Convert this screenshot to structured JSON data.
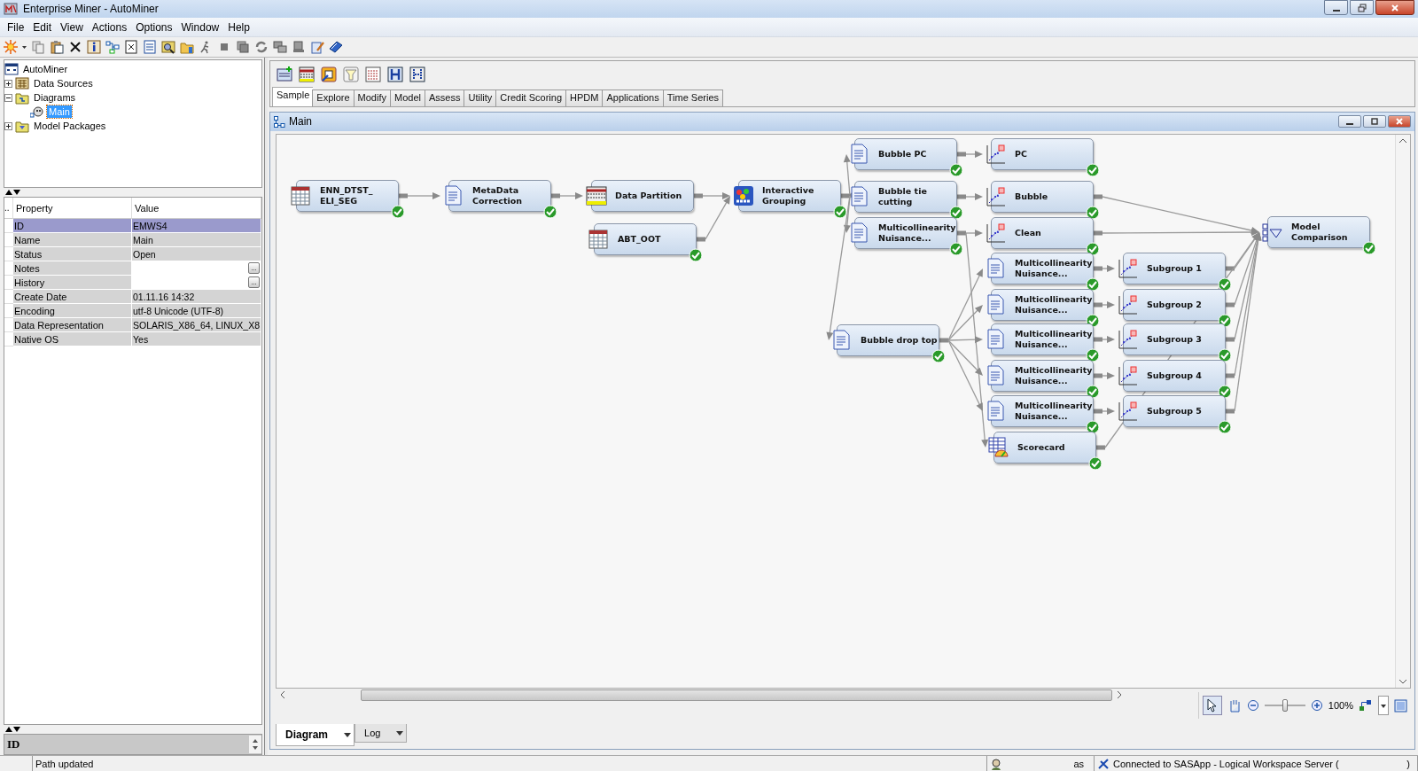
{
  "window": {
    "title": "Enterprise Miner - AutoMiner"
  },
  "menu": [
    "File",
    "Edit",
    "View",
    "Actions",
    "Options",
    "Window",
    "Help"
  ],
  "project_tree": [
    {
      "label": "AutoMiner",
      "kind": "project",
      "children": [
        {
          "label": "Data Sources",
          "kind": "datasources",
          "expanded": false,
          "selected": false
        },
        {
          "label": "Diagrams",
          "kind": "diagrams",
          "expanded": true,
          "selected": false,
          "children": [
            {
              "label": "Main",
              "kind": "diagram",
              "selected": true
            }
          ]
        },
        {
          "label": "Model Packages",
          "kind": "packages",
          "expanded": false,
          "selected": false
        }
      ]
    }
  ],
  "properties": {
    "header_marker": "..",
    "columns": [
      "Property",
      "Value"
    ],
    "rows": [
      {
        "name": "ID",
        "value": "EMWS4",
        "selected": true
      },
      {
        "name": "Name",
        "value": "Main",
        "selected": false
      },
      {
        "name": "Status",
        "value": "Open",
        "selected": false
      },
      {
        "name": "Notes",
        "editor_button": "...",
        "selected": false
      },
      {
        "name": "History",
        "editor_button": "...",
        "selected": false
      },
      {
        "name": "Create Date",
        "value": "01.11.16 14:32",
        "selected": false
      },
      {
        "name": "Encoding",
        "value": "utf-8  Unicode (UTF-8)",
        "selected": false
      },
      {
        "name": "Data Representation",
        "value": "SOLARIS_X86_64, LINUX_X8",
        "selected": false
      },
      {
        "name": "Native OS",
        "value": "Yes",
        "selected": false
      }
    ]
  },
  "description_field": {
    "title": "ID"
  },
  "node_tabs": [
    {
      "label": "Sample",
      "selected": true
    },
    {
      "label": "Explore",
      "selected": false
    },
    {
      "label": "Modify",
      "selected": false
    },
    {
      "label": "Model",
      "selected": false
    },
    {
      "label": "Assess",
      "selected": false
    },
    {
      "label": "Utility",
      "selected": false
    },
    {
      "label": "Credit Scoring",
      "selected": false
    },
    {
      "label": "HPDM",
      "selected": false
    },
    {
      "label": "Applications",
      "selected": false
    },
    {
      "label": "Time Series",
      "selected": false
    }
  ],
  "diagram": {
    "title": "Main",
    "nodes": [
      {
        "label": "ENN_DTST_\nELI_SEG",
        "kind": "table",
        "completed": true
      },
      {
        "label": "MetaData\nCorrection",
        "kind": "document",
        "completed": true
      },
      {
        "label": "Data Partition",
        "kind": "partition",
        "completed": false
      },
      {
        "label": "ABT_OOT",
        "kind": "table",
        "completed": true
      },
      {
        "label": "Interactive\nGrouping",
        "kind": "grouping",
        "completed": true
      },
      {
        "label": "Bubble PC",
        "kind": "document",
        "completed": true
      },
      {
        "label": "Bubble tie\ncutting",
        "kind": "document",
        "completed": true
      },
      {
        "label": "Multicollinearity\nNuisance...",
        "kind": "document",
        "completed": true
      },
      {
        "label": "Bubble drop top",
        "kind": "document",
        "completed": true
      },
      {
        "label": "PC",
        "kind": "regression",
        "completed": true
      },
      {
        "label": "Bubble",
        "kind": "regression",
        "completed": true
      },
      {
        "label": "Clean",
        "kind": "regression",
        "completed": true
      },
      {
        "label": "Multicollinearity\nNuisance...",
        "kind": "document",
        "completed": true
      },
      {
        "label": "Multicollinearity\nNuisance...",
        "kind": "document",
        "completed": true
      },
      {
        "label": "Multicollinearity\nNuisance...",
        "kind": "document",
        "completed": true
      },
      {
        "label": "Multicollinearity\nNuisance...",
        "kind": "document",
        "completed": true
      },
      {
        "label": "Multicollinearity\nNuisance...",
        "kind": "document",
        "completed": true
      },
      {
        "label": "Scorecard",
        "kind": "scorecard",
        "completed": true
      },
      {
        "label": "Subgroup 1",
        "kind": "regression",
        "completed": true
      },
      {
        "label": "Subgroup 2",
        "kind": "regression",
        "completed": true
      },
      {
        "label": "Subgroup 3",
        "kind": "regression",
        "completed": true
      },
      {
        "label": "Subgroup 4",
        "kind": "regression",
        "completed": true
      },
      {
        "label": "Subgroup 5",
        "kind": "regression",
        "completed": true
      },
      {
        "label": "Model\nComparison",
        "kind": "comparison",
        "completed": true
      }
    ],
    "zoom": {
      "level": 0.5,
      "reading": "100%"
    },
    "bottom_tabs": [
      {
        "label": "Diagram",
        "selected": true
      },
      {
        "label": "Log",
        "selected": false
      }
    ]
  },
  "status_bar": {
    "message": "Path updated",
    "user": "as",
    "connection": "Connected to SASApp - Logical Workspace Server (",
    "connection_end": ")"
  }
}
